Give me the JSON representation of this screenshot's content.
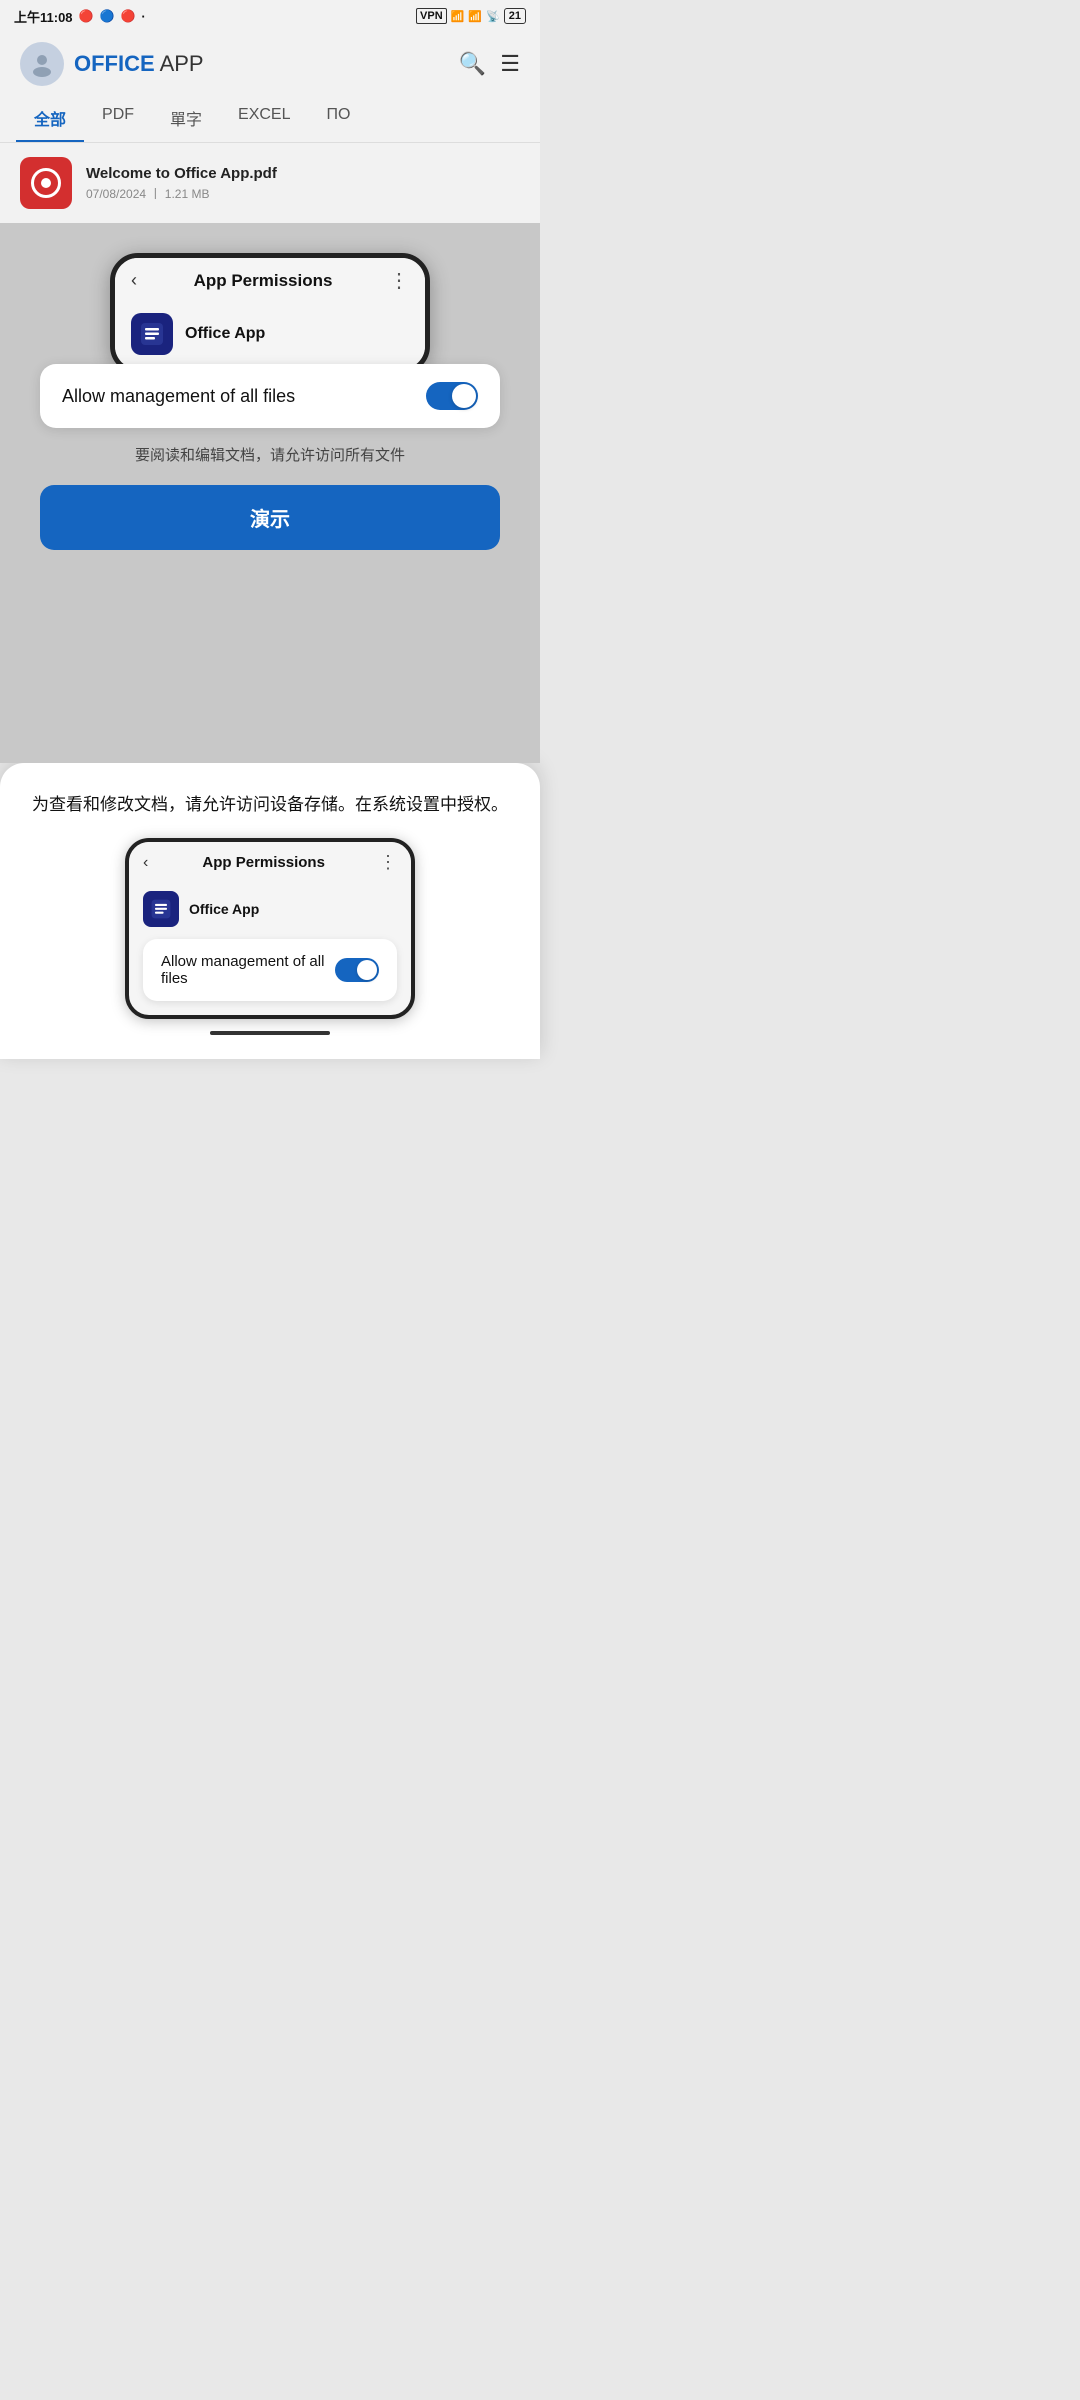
{
  "statusBar": {
    "time": "上午11:08",
    "vpn": "VPN",
    "hd1": "HD",
    "hd2": "HD",
    "battery": "21"
  },
  "nav": {
    "title_office": "OFFICE",
    "title_app": " APP"
  },
  "tabs": [
    {
      "id": "all",
      "label": "全部",
      "active": true
    },
    {
      "id": "pdf",
      "label": "PDF"
    },
    {
      "id": "word",
      "label": "單字"
    },
    {
      "id": "excel",
      "label": "EXCEL"
    },
    {
      "id": "more",
      "label": "ПО"
    }
  ],
  "fileItem": {
    "name": "Welcome to Office App.pdf",
    "date": "07/08/2024",
    "separator": "丨",
    "size": "1.21 MB"
  },
  "phoneScreen": {
    "backLabel": "‹",
    "title": "App Permissions",
    "moreLabel": "⋮",
    "appName": "Office App"
  },
  "toggleCard": {
    "label": "Allow management of all files",
    "enabled": true
  },
  "instructionText": "要阅读和编辑文档，请允许访问所有文件",
  "demoButton": {
    "label": "演示"
  },
  "bottomSheet": {
    "text": "为查看和修改文档，请允许访问设备存储。在系统设置中授权。",
    "phoneScreen": {
      "backLabel": "‹",
      "title": "App Permissions",
      "moreLabel": "⋮",
      "appName": "Office App"
    },
    "toggleLabel": "Allow management of all files"
  }
}
